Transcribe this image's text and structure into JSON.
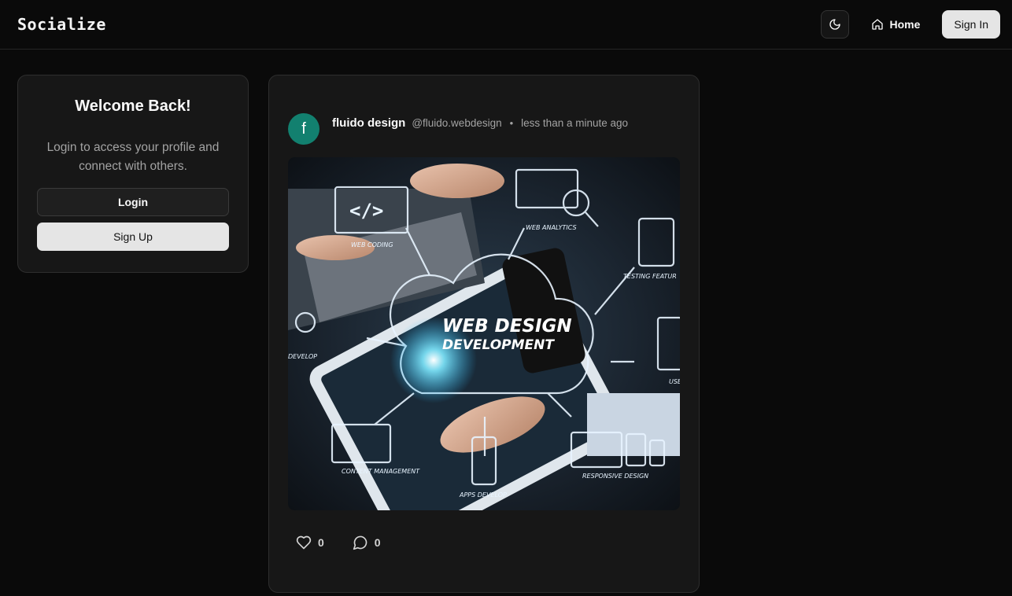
{
  "header": {
    "brand": "Socialize",
    "theme_toggle_icon": "moon-icon",
    "home_label": "Home",
    "home_icon": "home-icon",
    "signin_label": "Sign In"
  },
  "welcome": {
    "title": "Welcome Back!",
    "subtitle": "Login to access your profile and connect with others.",
    "login_label": "Login",
    "signup_label": "Sign Up"
  },
  "post": {
    "avatar_letter": "f",
    "author": "fluido design",
    "handle": "@fluido.webdesign",
    "separator": "•",
    "time": "less than a minute ago",
    "image_text": {
      "headline_1": "WEB DESIGN",
      "headline_2": "DEVELOPMENT",
      "labels": [
        "WEB CODING",
        "WEB ANALYTICS",
        "TESTING FEATUR",
        "DEVELOP",
        "USE",
        "CONTENT MANAGEMENT",
        "APPS DEVELOP",
        "RESPONSIVE DESIGN"
      ]
    },
    "likes": "0",
    "comments": "0"
  },
  "colors": {
    "background": "#0a0a0a",
    "card": "#171717",
    "avatar": "#12806f",
    "light_button": "#e5e5e5"
  }
}
